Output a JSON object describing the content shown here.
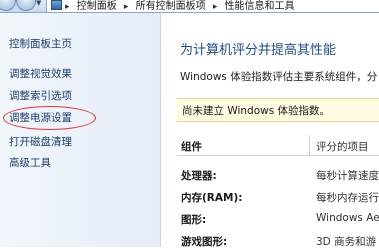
{
  "address_bar": {
    "crumbs": [
      "控制面板",
      "所有控制面板项",
      "性能信息和工具"
    ]
  },
  "sidebar": {
    "home": "控制面板主页",
    "links": [
      "调整视觉效果",
      "调整索引选项",
      "调整电源设置",
      "打开磁盘清理",
      "高级工具"
    ]
  },
  "main": {
    "title": "为计算机评分并提高其性能",
    "description": "Windows 体验指数评估主要系统组件，分",
    "notice": "尚未建立 Windows 体验指数。",
    "table": {
      "headers": [
        "组件",
        "评分的项目"
      ],
      "rows": [
        {
          "component": "处理器:",
          "item": "每秒计算速度"
        },
        {
          "component": "内存(RAM):",
          "item": "每秒内存运行"
        },
        {
          "component": "图形:",
          "item": "Windows Ae"
        },
        {
          "component": "游戏图形:",
          "item": "3D 商务和游"
        }
      ]
    }
  },
  "colors": {
    "title_blue": "#1f4c8c",
    "link_blue": "#1d3f6e",
    "annotation_red": "#e03232",
    "notice_bg": "#fffbe0"
  }
}
